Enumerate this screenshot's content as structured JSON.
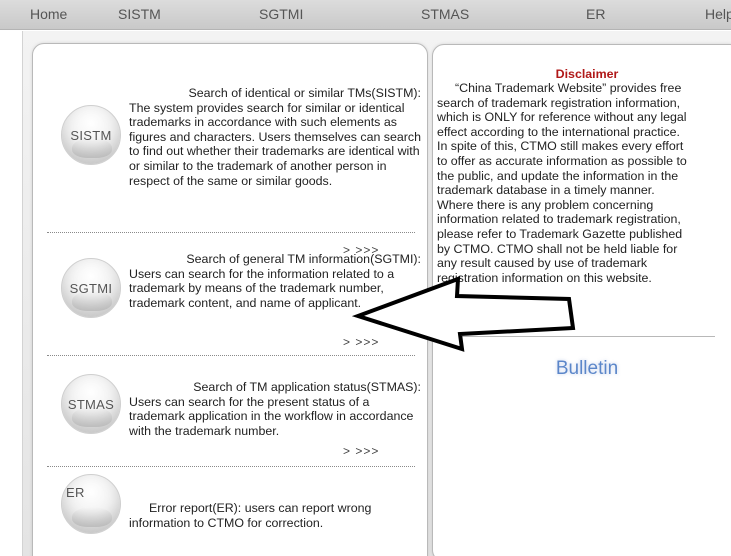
{
  "navbar": {
    "items": [
      "Home",
      "SISTM",
      "SGTMI",
      "STMAS",
      "ER",
      "Help"
    ]
  },
  "sections": [
    {
      "logo": "SISTM",
      "title": "Search of identical or similar TMs(SISTM):",
      "body": "The system provides search for similar or identical trademarks in accordance with such elements as figures and characters. Users themselves can search to find out whether their trademarks are identical with or similar to the trademark of another person in respect of the same or similar goods.",
      "more": "> >>>"
    },
    {
      "logo": "SGTMI",
      "title": "Search of general TM information(SGTMI):",
      "body": "Users can search for the information related to a trademark by means of the trademark number, trademark content, and name of applicant.",
      "more": "> >>>"
    },
    {
      "logo": "STMAS",
      "title": "Search of TM application status(STMAS):",
      "body": "Users can search for the present status of a trademark application in the workflow in accordance with the trademark number.",
      "more": "> >>>"
    },
    {
      "logo": "ER",
      "title": "Error report(ER): users can report wrong information to CTMO for correction.",
      "body": "",
      "more": "> >>>"
    }
  ],
  "disclaimer": {
    "title": "Disclaimer",
    "lines": [
      "“China Trademark Website” provides free",
      "search of trademark registration information,",
      "which is ONLY for reference without any legal",
      "effect according to the international practice.",
      "In spite of this, CTMO still makes every effort",
      "to offer as accurate information as possible to",
      "the public, and update the information in the",
      "trademark database in a timely manner.",
      "Where there is any problem concerning",
      "information related to trademark registration,",
      "please refer to Trademark Gazette published",
      "by CTMO. CTMO shall not be held liable for",
      "any result caused by use of trademark",
      "registration information on this website."
    ]
  },
  "bulletin": "Bulletin",
  "colors": {
    "disclaimer_title": "#b01818",
    "bulletin": "#5b86c9",
    "navbar_bg": "#d2d2d2"
  },
  "icons": {
    "section_logo": "silver-globe-icon",
    "annotation": "left-pointing-arrow-icon"
  }
}
